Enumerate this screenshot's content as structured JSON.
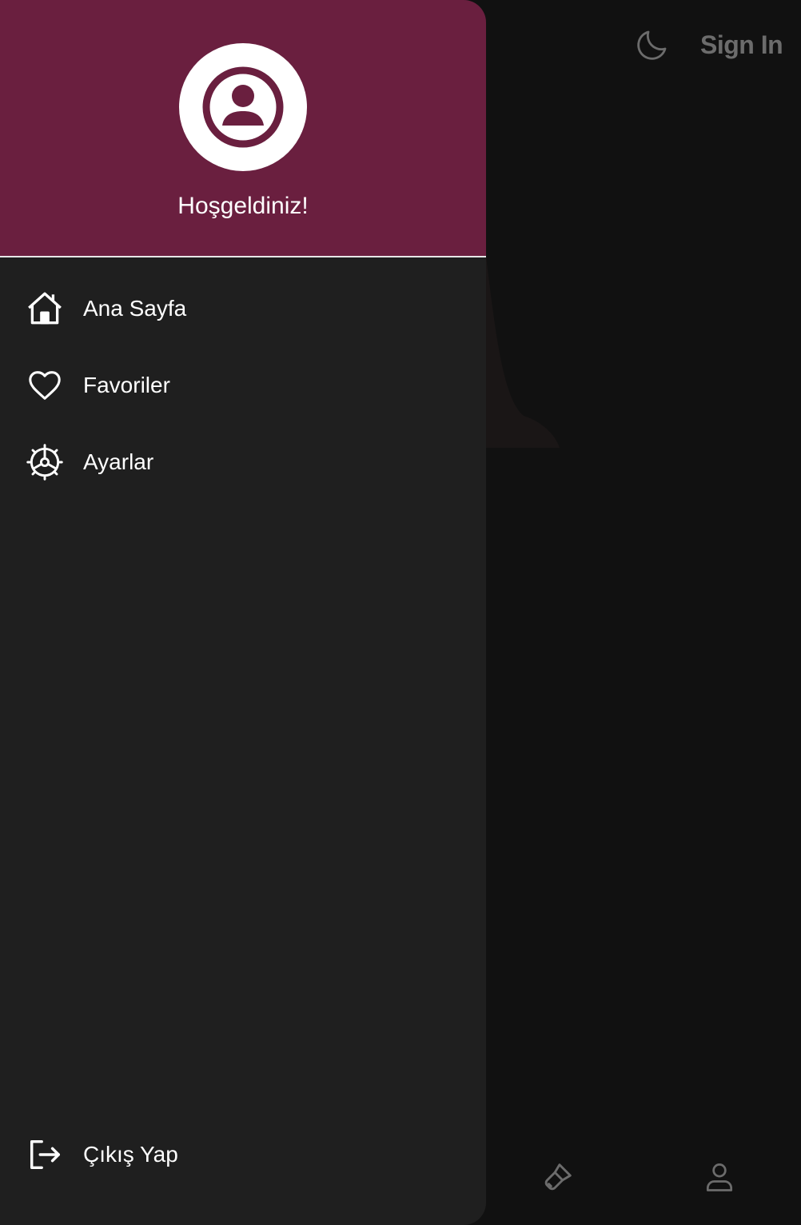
{
  "topbar": {
    "theme_toggle_icon": "moon-icon",
    "signin_label": "Sign In"
  },
  "bottombar": {
    "items": [
      {
        "icon": "brush-icon"
      },
      {
        "icon": "user-icon"
      }
    ]
  },
  "drawer": {
    "avatar_icon": "account-circle-icon",
    "welcome_text": "Hoşgeldiniz!",
    "header_color": "#6a1f3f",
    "background_color": "#1f1f1f",
    "menu": [
      {
        "icon": "home-icon",
        "label": "Ana Sayfa"
      },
      {
        "icon": "heart-icon",
        "label": "Favoriler"
      },
      {
        "icon": "gear-icon",
        "label": "Ayarlar"
      }
    ],
    "logout": {
      "icon": "logout-icon",
      "label": "Çıkış Yap"
    }
  }
}
